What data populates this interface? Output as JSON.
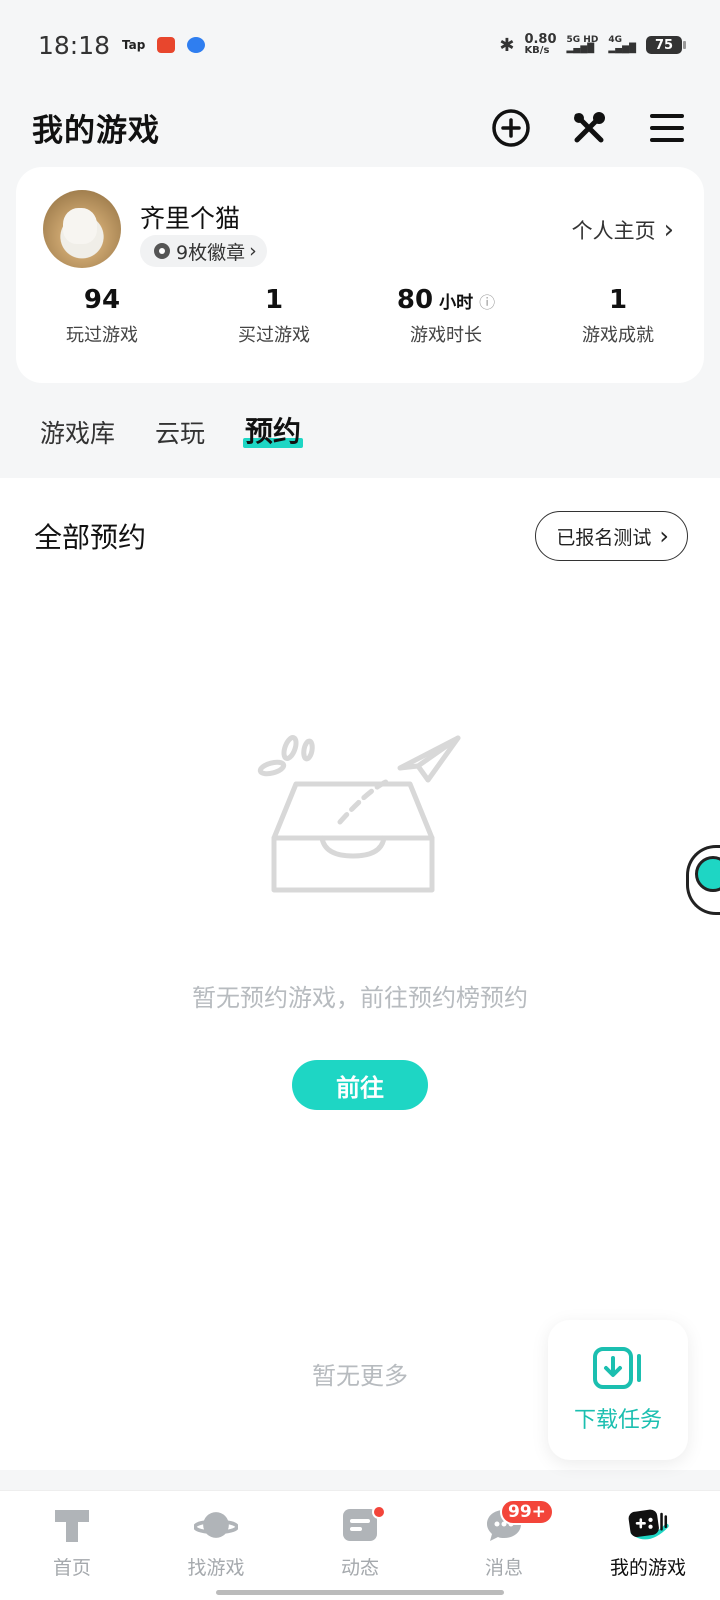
{
  "status": {
    "time": "18:18",
    "tap": "Tap",
    "net_speed": "0.80",
    "net_unit": "KB/s",
    "sig1": "5G HD",
    "sig2": "4G",
    "battery": "75"
  },
  "header": {
    "title": "我的游戏"
  },
  "profile": {
    "name": "齐里个猫",
    "badges": "9枚徽章",
    "homepage": "个人主页",
    "stats": [
      {
        "value": "94",
        "unit": "",
        "label": "玩过游戏"
      },
      {
        "value": "1",
        "unit": "",
        "label": "买过游戏"
      },
      {
        "value": "80",
        "unit": "小时",
        "label": "游戏时长"
      },
      {
        "value": "1",
        "unit": "",
        "label": "游戏成就"
      }
    ]
  },
  "tabs": [
    {
      "label": "游戏库"
    },
    {
      "label": "云玩"
    },
    {
      "label": "预约"
    }
  ],
  "section": {
    "title": "全部预约",
    "signed_btn": "已报名测试"
  },
  "empty": {
    "text": "暂无预约游戏，前往预约榜预约",
    "go_btn": "前往",
    "no_more": "暂无更多"
  },
  "fab": {
    "label": "下载任务"
  },
  "nav": [
    {
      "label": "首页"
    },
    {
      "label": "找游戏"
    },
    {
      "label": "动态"
    },
    {
      "label": "消息",
      "badge": "99+"
    },
    {
      "label": "我的游戏"
    }
  ],
  "colors": {
    "accent": "#1ed6c4",
    "badge_red": "#f3453a"
  }
}
